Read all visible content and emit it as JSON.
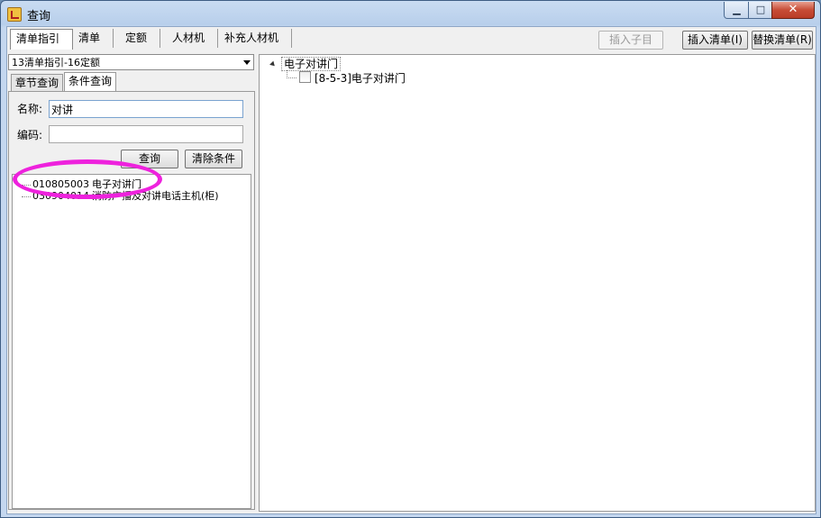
{
  "window": {
    "title": "查询",
    "min_glyph": "▁",
    "max_glyph": "□",
    "close_glyph": "✕"
  },
  "tabs": [
    "清单指引",
    "清单",
    "定额",
    "人材机",
    "补充人材机"
  ],
  "toolbar": {
    "insert_child": "插入子目",
    "insert_list": "插入清单(I)",
    "replace_list": "替换清单(R)"
  },
  "left": {
    "combo_value": "13清单指引-16定额",
    "subtabs": [
      "章节查询",
      "条件查询"
    ],
    "name_label": "名称:",
    "name_value": "对讲",
    "code_label": "编码:",
    "code_value": "",
    "query_button": "查询",
    "clear_button": "清除条件",
    "results": [
      {
        "code": "010805003",
        "name": "电子对讲门"
      },
      {
        "code": "030904014",
        "name": "消防广播及对讲电话主机(柜)"
      }
    ]
  },
  "right": {
    "root": "电子对讲门",
    "child": "[8-5-3]电子对讲门"
  },
  "colors": {
    "highlight": "#ee22dd",
    "title_bar": "#b8cfeb"
  }
}
